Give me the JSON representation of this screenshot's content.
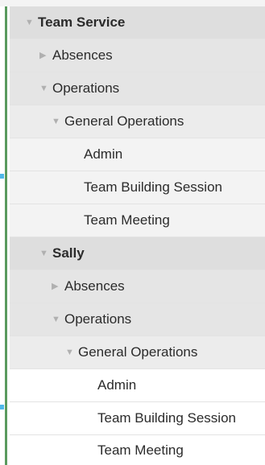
{
  "tree": {
    "nodes": [
      {
        "label": "Team Service",
        "expander": "collapse-arrow-icon"
      },
      {
        "label": "Absences",
        "expander": "expand-arrow-icon"
      },
      {
        "label": "Operations",
        "expander": "collapse-arrow-icon"
      },
      {
        "label": "General Operations",
        "expander": "collapse-arrow-icon"
      },
      {
        "label": "Admin"
      },
      {
        "label": "Team Building Session"
      },
      {
        "label": "Team Meeting"
      },
      {
        "label": "Sally",
        "expander": "collapse-arrow-icon"
      },
      {
        "label": "Absences",
        "expander": "expand-arrow-icon"
      },
      {
        "label": "Operations",
        "expander": "collapse-arrow-icon"
      },
      {
        "label": "General Operations",
        "expander": "collapse-arrow-icon"
      },
      {
        "label": "Admin"
      },
      {
        "label": "Team Building Session"
      },
      {
        "label": "Team Meeting"
      }
    ],
    "glyphs": {
      "collapsed": "▶",
      "expanded": "▼"
    }
  },
  "colors": {
    "left_bar": "#5a9a5e",
    "marker": "#4fb8e8",
    "group_bg": "#dedede",
    "leaf_bg": "#f3f3f3"
  }
}
